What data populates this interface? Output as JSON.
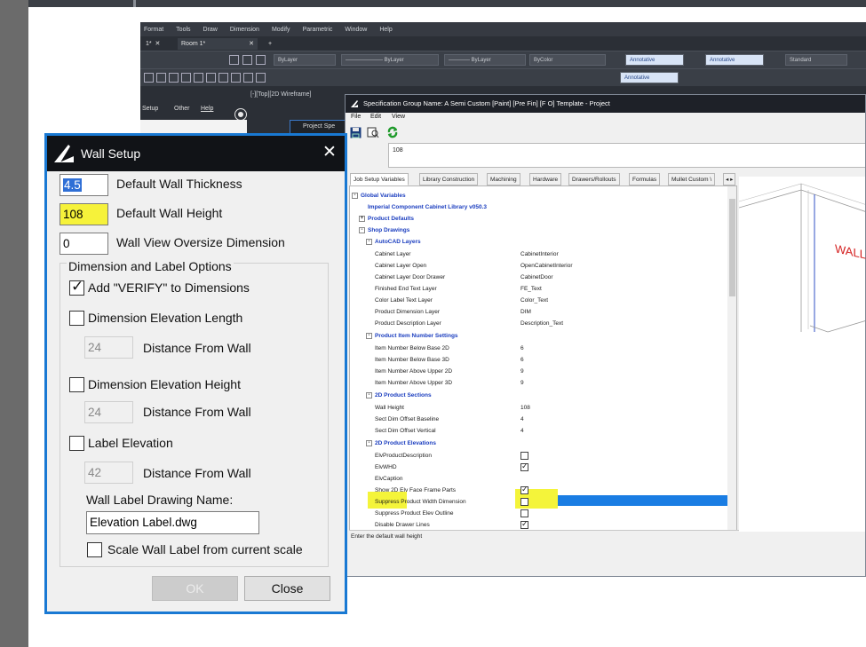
{
  "cad": {
    "menu": [
      "Format",
      "Tools",
      "Draw",
      "Dimension",
      "Modify",
      "Parametric",
      "Window",
      "Help"
    ],
    "tabs": {
      "prev_tab": "1*",
      "active_tab": "Room 1*",
      "add": "+"
    },
    "toolbar": {
      "layer1": "ByLayer",
      "layer2": "ByLayer",
      "layer3": "ByLayer",
      "color": "ByColor",
      "annot1": "Annotative",
      "annot2": "Annotative",
      "standard": "Standard",
      "annot3": "Annotative"
    },
    "viewport_label": "[-][Top][2D Wireframe]",
    "side_menu": [
      "Setup",
      "Other",
      "Help"
    ],
    "project_tab": "Project Spe"
  },
  "spec_window": {
    "title": "Specification Group Name: A Semi Custom [Paint] [Pre Fin] [F O] Template - Project",
    "menu": [
      "File",
      "Edit",
      "View"
    ],
    "entry_value": "108",
    "tabs": [
      "Job Setup Variables",
      "Library Construction",
      "Machining",
      "Hardware",
      "Drawers/Rollouts",
      "Formulas",
      "Mullet Custom \\"
    ],
    "tree": {
      "global": "Global Variables",
      "library": "Imperial Component Cabinet Library v050.3",
      "product_defaults": "Product Defaults",
      "shop_drawings": "Shop Drawings",
      "autocad_layers": "AutoCAD Layers",
      "layers": [
        {
          "name": "Cabinet Layer",
          "value": "CabinetInterior"
        },
        {
          "name": "Cabinet Layer Open",
          "value": "OpenCabinetInterior"
        },
        {
          "name": "Cabinet Layer Door Drawer",
          "value": "CabinetDoor"
        },
        {
          "name": "Finished End Text Layer",
          "value": "FE_Text"
        },
        {
          "name": "Color Label Text Layer",
          "value": "Color_Text"
        },
        {
          "name": "Product Dimension Layer",
          "value": "DIM"
        },
        {
          "name": "Product Description Layer",
          "value": "Description_Text"
        }
      ],
      "item_settings": "Product Item Number Settings",
      "items": [
        {
          "name": "Item Number Below Base 2D",
          "value": "6"
        },
        {
          "name": "Item Number Below Base 3D",
          "value": "6"
        },
        {
          "name": "Item Number Above Upper 2D",
          "value": "9"
        },
        {
          "name": "Item Number Above Upper 3D",
          "value": "9"
        }
      ],
      "sections": "2D Product Sections",
      "section_items": [
        {
          "name": "Wall Height",
          "value": "108"
        },
        {
          "name": "Sect Dim Offset Baseline",
          "value": "4"
        },
        {
          "name": "Sect Dim Offset Vertical",
          "value": "4"
        }
      ],
      "elevations": "2D Product Elevations",
      "elev_items": [
        {
          "name": "ElvProductDescription",
          "checked": false
        },
        {
          "name": "ElvWHD",
          "checked": true
        },
        {
          "name": "ElvCaption",
          "checked": null
        },
        {
          "name": "Show 2D Elv Face Frame Parts",
          "checked": true
        },
        {
          "name": "Suppress Product Width Dimension",
          "checked": false
        },
        {
          "name": "Suppress Product Elev Outline",
          "checked": false
        },
        {
          "name": "Disable Drawer Lines",
          "checked": true
        }
      ]
    },
    "status_text": "Enter the default wall height",
    "preview_label": "WALL",
    "highlight_color": "#f4f43a",
    "selection_color": "#1a7de3"
  },
  "dialog": {
    "title": "Wall Setup",
    "thickness_value": "4.5",
    "thickness_label": "Default Wall Thickness",
    "height_value": "108",
    "height_label": "Default Wall Height",
    "oversize_value": "0",
    "oversize_label": "Wall View Oversize Dimension",
    "group_title": "Dimension and Label Options",
    "verify_label": "Add \"VERIFY\" to Dimensions",
    "dim_length_label": "Dimension Elevation Length",
    "dim_length_distance": "24",
    "distance_label": "Distance From Wall",
    "dim_height_label": "Dimension Elevation Height",
    "dim_height_distance": "24",
    "label_elev_label": "Label Elevation",
    "label_elev_distance": "42",
    "drawing_name_label": "Wall Label Drawing Name:",
    "drawing_name_value": "Elevation Label.dwg",
    "scale_label": "Scale Wall Label from current scale",
    "ok": "OK",
    "close": "Close",
    "accent_color": "#1979d3"
  }
}
